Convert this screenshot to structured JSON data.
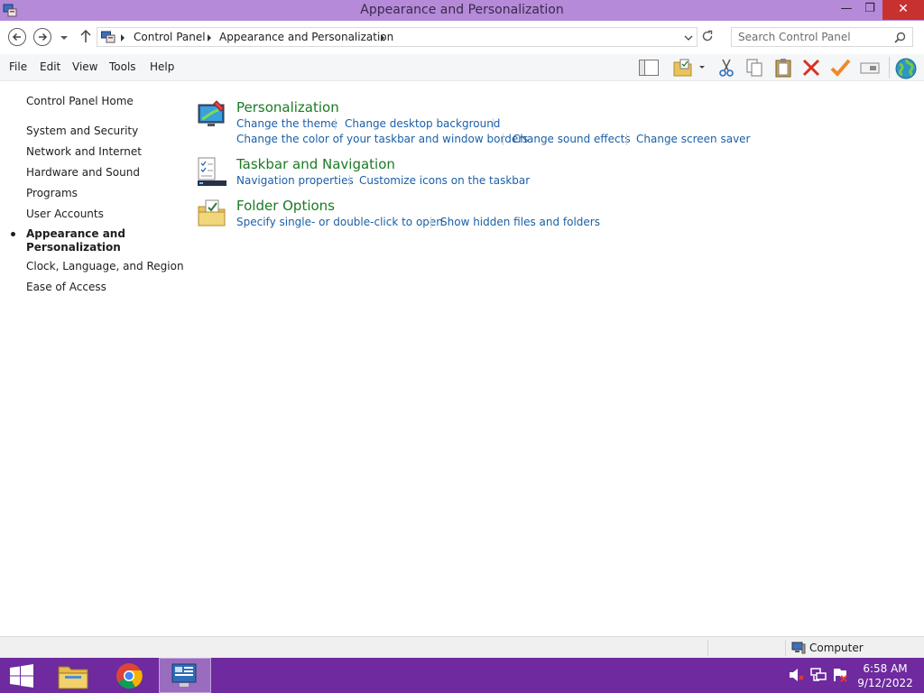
{
  "window": {
    "title": "Appearance and Personalization",
    "controls": {
      "minimize": "—",
      "maximize": "❐",
      "close": "✕"
    }
  },
  "address_bar": {
    "breadcrumbs": [
      "Control Panel",
      "Appearance and Personalization"
    ],
    "search_placeholder": "Search Control Panel"
  },
  "menu": [
    "File",
    "Edit",
    "View",
    "Tools",
    "Help"
  ],
  "toolbar_icons": [
    "layout-icon",
    "folder-options-icon",
    "cut-icon",
    "copy-icon",
    "paste-icon",
    "delete-icon",
    "properties-icon",
    "rename-icon",
    "globe-icon"
  ],
  "sidebar": {
    "home": "Control Panel Home",
    "items": [
      "System and Security",
      "Network and Internet",
      "Hardware and Sound",
      "Programs",
      "User Accounts",
      "Appearance and",
      "Personalization",
      "Clock, Language, and Region",
      "Ease of Access"
    ]
  },
  "categories": [
    {
      "title": "Personalization",
      "links": [
        "Change the theme",
        "Change desktop background",
        "Change the color of your taskbar and window borders",
        "Change sound effects",
        "Change screen saver"
      ]
    },
    {
      "title": "Taskbar and Navigation",
      "links": [
        "Navigation properties",
        "Customize icons on the taskbar"
      ]
    },
    {
      "title": "Folder Options",
      "links": [
        "Specify single- or double-click to open",
        "Show hidden files and folders"
      ]
    }
  ],
  "status_bar": {
    "location": "Computer"
  },
  "taskbar": {
    "time": "6:58 AM",
    "date": "9/12/2022"
  },
  "colors": {
    "titlebar": "#b58ad8",
    "taskbar": "#6e2a9e",
    "category_title": "#1b7a23",
    "link": "#1a5fa8"
  }
}
